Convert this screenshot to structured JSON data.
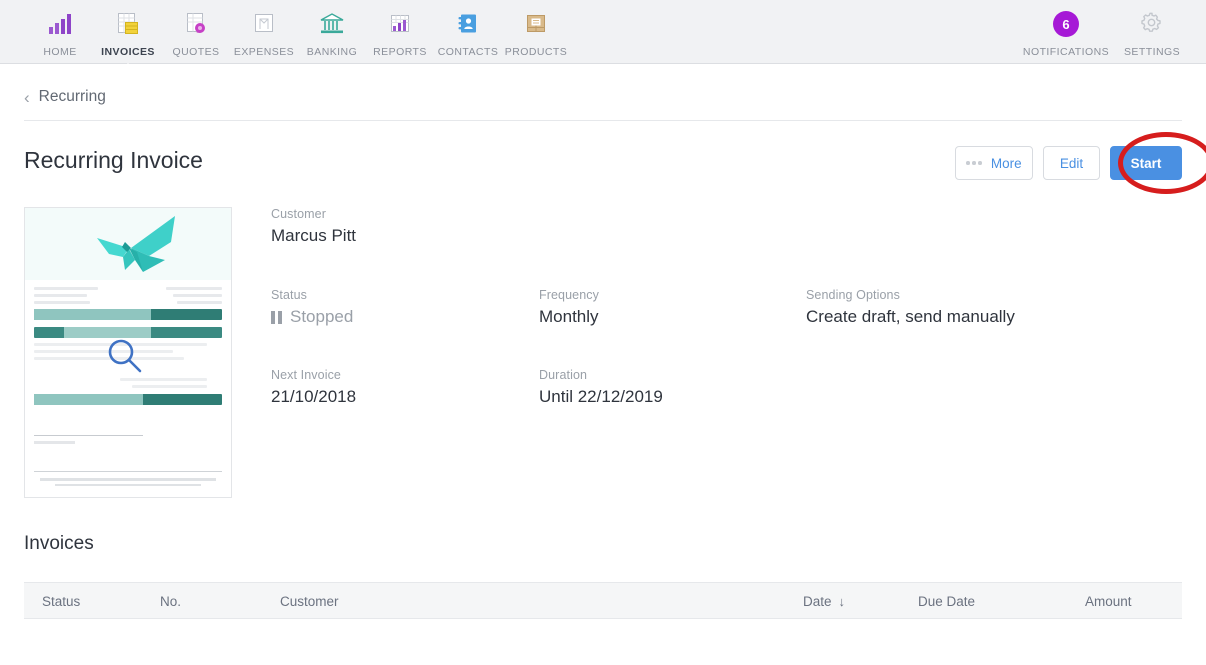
{
  "nav": {
    "items": [
      {
        "label": "HOME",
        "icon": "bar-chart-icon",
        "active": false
      },
      {
        "label": "INVOICES",
        "icon": "invoice-document-icon",
        "active": true
      },
      {
        "label": "QUOTES",
        "icon": "quote-document-icon",
        "active": false
      },
      {
        "label": "EXPENSES",
        "icon": "expenses-tray-icon",
        "active": false
      },
      {
        "label": "BANKING",
        "icon": "bank-building-icon",
        "active": false
      },
      {
        "label": "REPORTS",
        "icon": "reports-chart-icon",
        "active": false
      },
      {
        "label": "CONTACTS",
        "icon": "contacts-book-icon",
        "active": false
      },
      {
        "label": "PRODUCTS",
        "icon": "products-box-icon",
        "active": false
      }
    ],
    "right": [
      {
        "label": "NOTIFICATIONS",
        "icon": "notification-badge-icon",
        "badge": "6"
      },
      {
        "label": "SETTINGS",
        "icon": "gear-icon",
        "badge": ""
      }
    ],
    "badge_color": "#a619d6"
  },
  "breadcrumb": {
    "back_icon": "chevron-left-icon",
    "label": "Recurring"
  },
  "header": {
    "title": "Recurring Invoice",
    "more_label": "More",
    "edit_label": "Edit",
    "start_label": "Start",
    "primary_color": "#4a90e2",
    "annotation_color": "#d61d1d"
  },
  "details": {
    "customer": {
      "label": "Customer",
      "value": "Marcus Pitt"
    },
    "status": {
      "label": "Status",
      "value": "Stopped",
      "icon": "pause-icon"
    },
    "frequency": {
      "label": "Frequency",
      "value": "Monthly"
    },
    "sending_options": {
      "label": "Sending Options",
      "value": "Create draft, send manually"
    },
    "next_invoice": {
      "label": "Next Invoice",
      "value": "21/10/2018"
    },
    "duration": {
      "label": "Duration",
      "value": "Until 22/12/2019"
    }
  },
  "preview": {
    "name": "invoice-preview-thumbnail",
    "zoom_icon": "magnifier-icon"
  },
  "invoices": {
    "section_title": "Invoices",
    "columns": [
      {
        "label": "Status",
        "sort": ""
      },
      {
        "label": "No.",
        "sort": ""
      },
      {
        "label": "Customer",
        "sort": ""
      },
      {
        "label": "Date",
        "sort": "↓"
      },
      {
        "label": "Due Date",
        "sort": ""
      },
      {
        "label": "Amount",
        "sort": ""
      }
    ],
    "rows": []
  }
}
